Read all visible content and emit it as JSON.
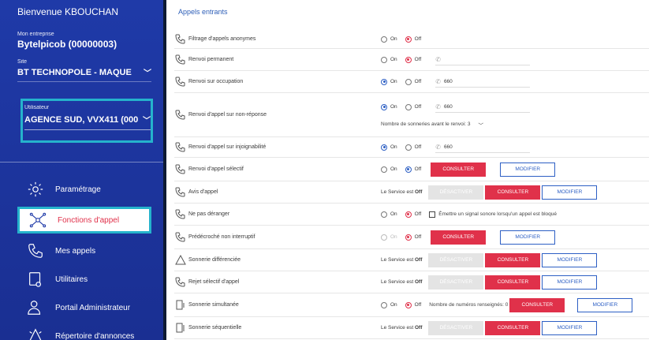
{
  "sidebar": {
    "welcome": "Bienvenue KBOUCHAN",
    "company_label": "Mon entreprise",
    "company": "Bytelpicob (00000003)",
    "site_label": "Site",
    "site": "BT TECHNOPOLE - MAQUE",
    "user_label": "Utilisateur",
    "user": "AGENCE SUD, VVX411 (000",
    "menu": [
      {
        "label": "Paramétrage",
        "icon": "settings-gear-icon"
      },
      {
        "label": "Fonctions d'appel",
        "icon": "network-nodes-icon"
      },
      {
        "label": "Mes appels",
        "icon": "phone-icon"
      },
      {
        "label": "Utilitaires",
        "icon": "device-icon"
      },
      {
        "label": "Portail Administrateur",
        "icon": "admin-user-icon"
      },
      {
        "label": "Répertoire d'annonces",
        "icon": "announcement-icon"
      }
    ]
  },
  "main": {
    "title": "Appels entrants",
    "on": "On",
    "off": "Off",
    "service_prefix": "Le Service est",
    "service_off": "Off",
    "btn_consulter": "CONSULTER",
    "btn_modifier": "MODIFIER",
    "btn_desactiver": "DÉSACTIVER",
    "rows": [
      {
        "label": "Filtrage d'appels anonymes"
      },
      {
        "label": "Renvoi permanent",
        "phone": ""
      },
      {
        "label": "Renvoi sur occupation",
        "phone": "660"
      },
      {
        "label": "Renvoi d'appel sur non-réponse",
        "phone": "660",
        "rings_label": "Nombre de sonneries avant le renvoi: 3"
      },
      {
        "label": "Renvoi d'appel sur injoignabilité",
        "phone": "660"
      },
      {
        "label": "Renvoi d'appel sélectif"
      },
      {
        "label": "Avis d'appel"
      },
      {
        "label": "Ne pas déranger",
        "checkbox": "Émettre un signal sonore lorsqu'un appel est bloqué"
      },
      {
        "label": "Prédécroché non interruptif"
      },
      {
        "label": "Sonnerie différenciée"
      },
      {
        "label": "Rejet sélectif d'appel"
      },
      {
        "label": "Sonnerie simultanée",
        "count": "Nombre de numéros renseignés: 0"
      },
      {
        "label": "Sonnerie séquentielle"
      }
    ]
  },
  "colors": {
    "accent": "#e0314a",
    "blue": "#2d5fc4",
    "highlight": "#25b3cc",
    "sidebar": "#1f3aa8"
  }
}
